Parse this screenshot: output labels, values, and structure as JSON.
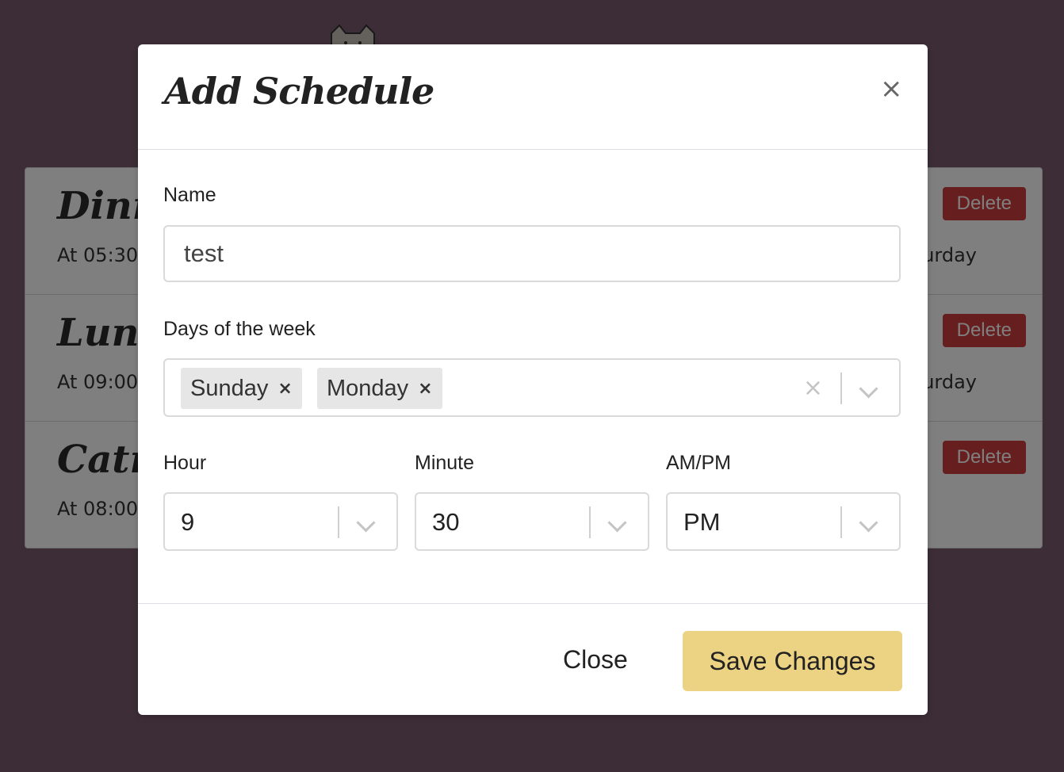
{
  "background": {
    "schedules": [
      {
        "name": "Dinne",
        "time": "At 05:30",
        "days": "urday",
        "delete_label": "Delete"
      },
      {
        "name": "Lunch",
        "time": "At 09:00",
        "days": "urday",
        "delete_label": "Delete"
      },
      {
        "name": "Catni",
        "time": "At 08:00",
        "days": "",
        "delete_label": "Delete"
      }
    ]
  },
  "modal": {
    "title": "Add Schedule",
    "close_icon": "×",
    "name_label": "Name",
    "name_value": "test",
    "days_label": "Days of the week",
    "days_selected": [
      "Sunday",
      "Monday"
    ],
    "chip_remove_icon": "×",
    "clear_icon": "×",
    "hour_label": "Hour",
    "hour_value": "9",
    "minute_label": "Minute",
    "minute_value": "30",
    "ampm_label": "AM/PM",
    "ampm_value": "PM",
    "close_button": "Close",
    "save_button": "Save Changes"
  },
  "colors": {
    "page_background": "#7b5b6d",
    "delete_button": "#cf3d3d",
    "save_button": "#ecd283"
  }
}
